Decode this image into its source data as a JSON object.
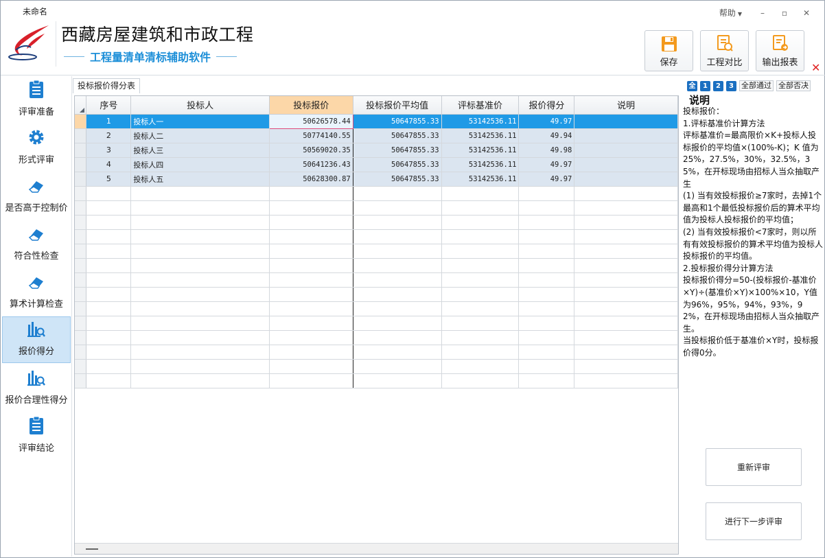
{
  "window": {
    "title": "未命名",
    "help_label": "帮助",
    "minimize_glyph": "–",
    "maximize_glyph": "▫"
  },
  "header": {
    "title": "西藏房屋建筑和市政工程",
    "subtitle": "工程量清单清标辅助软件",
    "buttons": [
      {
        "label": "保存",
        "icon": "save-icon"
      },
      {
        "label": "工程对比",
        "icon": "compare-icon"
      },
      {
        "label": "输出报表",
        "icon": "export-report-icon"
      }
    ],
    "close_glyph": "✕"
  },
  "sidebar": {
    "items": [
      {
        "label": "评审准备",
        "icon": "clipboard-icon",
        "active": false
      },
      {
        "label": "形式评审",
        "icon": "gear-icon",
        "active": false
      },
      {
        "label": "是否高于控制价",
        "icon": "eraser-icon",
        "active": false
      },
      {
        "label": "符合性检查",
        "icon": "eraser-icon",
        "active": false
      },
      {
        "label": "算术计算检查",
        "icon": "eraser-icon",
        "active": false
      },
      {
        "label": "报价得分",
        "icon": "bar-chart-search-icon",
        "active": true
      },
      {
        "label": "报价合理性得分",
        "icon": "bar-chart-search-icon",
        "active": false
      },
      {
        "label": "评审结论",
        "icon": "clipboard-icon",
        "active": false
      }
    ]
  },
  "tab": {
    "label": "投标报价得分表"
  },
  "grid": {
    "columns": [
      "序号",
      "投标人",
      "投标报价",
      "投标报价平均值",
      "评标基准价",
      "报价得分",
      "说明"
    ],
    "selected_column": "投标报价",
    "rows": [
      {
        "no": "1",
        "bidder": "投标人一",
        "price": "50626578.44",
        "avg": "50647855.33",
        "base": "53142536.11",
        "score": "49.97",
        "note": ""
      },
      {
        "no": "2",
        "bidder": "投标人二",
        "price": "50774140.55",
        "avg": "50647855.33",
        "base": "53142536.11",
        "score": "49.94",
        "note": ""
      },
      {
        "no": "3",
        "bidder": "投标人三",
        "price": "50569020.35",
        "avg": "50647855.33",
        "base": "53142536.11",
        "score": "49.98",
        "note": ""
      },
      {
        "no": "4",
        "bidder": "投标人四",
        "price": "50641236.43",
        "avg": "50647855.33",
        "base": "53142536.11",
        "score": "49.97",
        "note": ""
      },
      {
        "no": "5",
        "bidder": "投标人五",
        "price": "50628300.87",
        "avg": "50647855.33",
        "base": "53142536.11",
        "score": "49.97",
        "note": ""
      }
    ],
    "empty_rows": 14
  },
  "right_panel": {
    "toolbar": {
      "all": "全",
      "one": "1",
      "two": "2",
      "three": "3",
      "pass_all": "全部通过",
      "reject_all": "全部否决"
    },
    "title": "说明",
    "paragraphs": [
      "投标报价：",
      "1.评标基准价计算方法",
      "评标基准价=最高限价×K+投标人投标报价的平均值×(100%-K)；K 值为25%，27.5%，30%，32.5%，35%，在开标现场由招标人当众抽取产生",
      "(1) 当有效投标报价≥7家时，去掉1个最高和1个最低投标报价后的算术平均值为投标人投标报价的平均值；",
      "(2) 当有效投标报价<7家时，则以所有有效投标报价的算术平均值为投标人投标报价的平均值。",
      "2.投标报价得分计算方法",
      "投标报价得分=50-(投标报价-基准价×Y)÷(基准价×Y)×100%×10，Y值为96%，95%，94%，93%，92%，在开标现场由招标人当众抽取产生。",
      "当投标报价低于基准价×Y时，投标报价得0分。"
    ],
    "buttons": {
      "re_review": "重新评审",
      "next_step": "进行下一步评审"
    }
  }
}
